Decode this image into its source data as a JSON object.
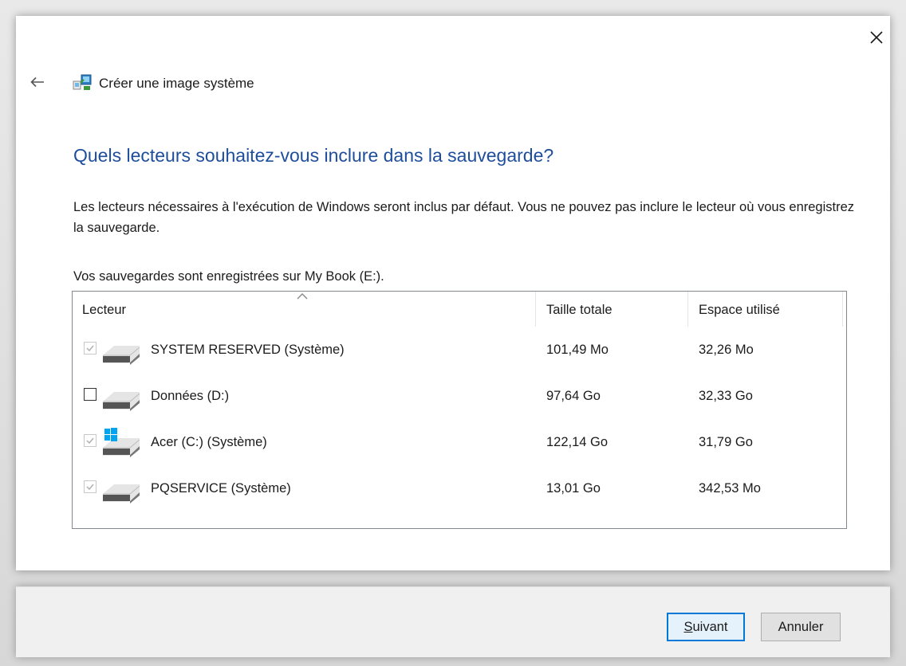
{
  "window": {
    "title": "Créer une image système",
    "heading": "Quels lecteurs souhaitez-vous inclure dans la sauvegarde?",
    "description": "Les lecteurs nécessaires à l'exécution de Windows seront inclus par défaut. Vous ne pouvez pas inclure le lecteur où vous enregistrez la sauvegarde.",
    "location_text": "Vos sauvegardes sont enregistrées sur My Book (E:)."
  },
  "table": {
    "columns": [
      "Lecteur",
      "Taille totale",
      "Espace utilisé"
    ],
    "rows": [
      {
        "name": "SYSTEM RESERVED (Système)",
        "total": "101,49 Mo",
        "used": "32,26 Mo",
        "checked": true,
        "enabled": false,
        "icon": "drive-icon"
      },
      {
        "name": "Données (D:)",
        "total": "97,64 Go",
        "used": "32,33 Go",
        "checked": false,
        "enabled": true,
        "icon": "drive-icon"
      },
      {
        "name": "Acer (C:) (Système)",
        "total": "122,14 Go",
        "used": "31,79 Go",
        "checked": true,
        "enabled": false,
        "icon": "windows-drive-icon"
      },
      {
        "name": "PQSERVICE (Système)",
        "total": "13,01 Go",
        "used": "342,53 Mo",
        "checked": true,
        "enabled": false,
        "icon": "drive-icon"
      }
    ]
  },
  "buttons": {
    "next_prefix": "S",
    "next_rest": "uivant",
    "cancel": "Annuler"
  },
  "icons": {
    "close": "close-icon",
    "back": "back-arrow-icon",
    "app": "system-image-icon",
    "sort": "sort-ascending-icon"
  },
  "colors": {
    "heading": "#1e4e9b",
    "default_button_border": "#0078d7",
    "windows_logo": "#00a4ef"
  }
}
